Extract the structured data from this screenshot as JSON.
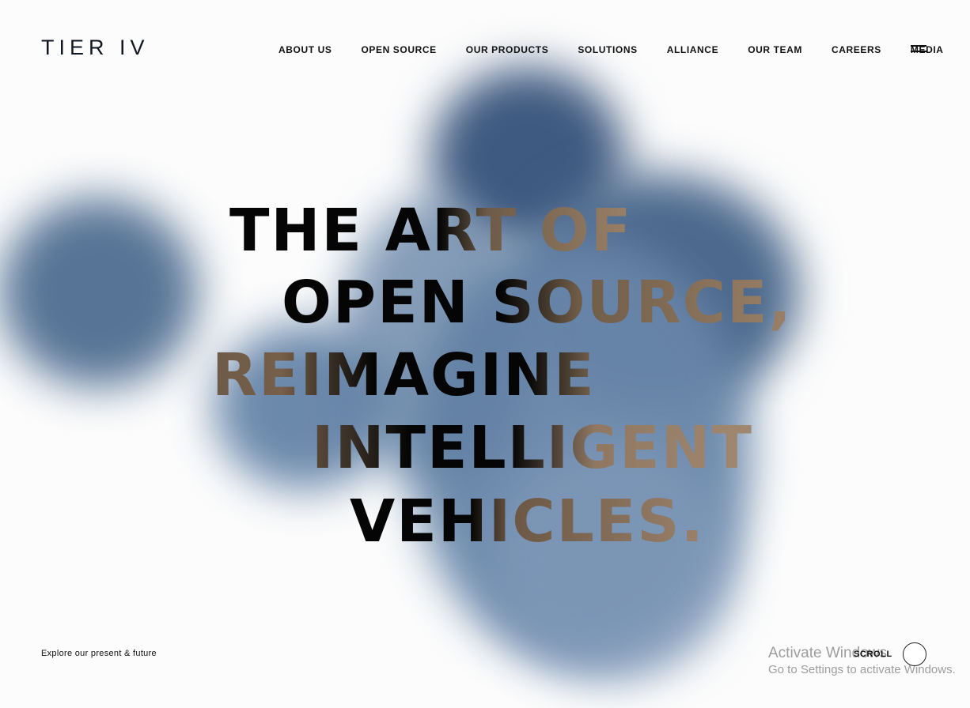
{
  "header": {
    "logo_text": "TIER IV",
    "nav": [
      {
        "label": "ABOUT US"
      },
      {
        "label": "OPEN SOURCE"
      },
      {
        "label": "OUR PRODUCTS"
      },
      {
        "label": "SOLUTIONS"
      },
      {
        "label": "ALLIANCE"
      },
      {
        "label": "OUR TEAM"
      },
      {
        "label": "CAREERS"
      },
      {
        "label": "MEDIA"
      }
    ]
  },
  "hero": {
    "lines": [
      "THE ART OF",
      "OPEN SOURCE,",
      "REIMAGINE",
      "INTELLIGENT",
      "VEHICLES."
    ]
  },
  "footer": {
    "explore_text": "Explore our present & future",
    "scroll_label": "SCROLL"
  },
  "system_overlay": {
    "activate_title": "Activate Windows",
    "activate_subtitle": "Go to Settings to activate Windows."
  },
  "icons": {
    "menu": "hamburger-menu-icon",
    "scroll": "circle-icon"
  },
  "colors": {
    "background": "#fcfcfc",
    "blob_blue": "#4f6d91",
    "headline_black": "#050505",
    "headline_bronze": "#9a8068"
  }
}
